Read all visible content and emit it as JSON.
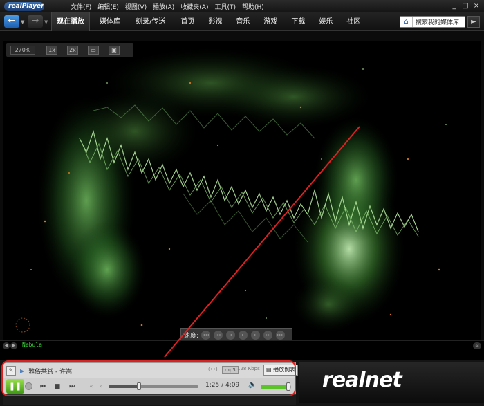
{
  "app": {
    "logo_text": "realPlayer",
    "menu": [
      "文件(F)",
      "编辑(E)",
      "视图(V)",
      "播放(A)",
      "收藏夹(A)",
      "工具(T)",
      "帮助(H)"
    ],
    "window_controls": [
      "_",
      "□",
      "×"
    ]
  },
  "nav": {
    "tabs": [
      {
        "label": "现在播放",
        "active": true
      },
      {
        "label": "媒体库",
        "active": false
      },
      {
        "label": "刻录/传送",
        "active": false
      },
      {
        "label": "首页",
        "active": false
      },
      {
        "label": "影视",
        "active": false
      },
      {
        "label": "音乐",
        "active": false
      },
      {
        "label": "游戏",
        "active": false
      },
      {
        "label": "下载",
        "active": false
      },
      {
        "label": "娱乐",
        "active": false
      },
      {
        "label": "社区",
        "active": false
      }
    ],
    "search_text": "搜索我的媒体库"
  },
  "video": {
    "zoom_level": "270%",
    "zoom_buttons": [
      "1x",
      "2x",
      "▭",
      "▣"
    ],
    "speed_label": "速度:",
    "speed_buttons": [
      "◂◂◂",
      "◂◂",
      "◂",
      "▸",
      "▸",
      "▸▸",
      "▸▸▸"
    ]
  },
  "visualization": {
    "name": "Nebula"
  },
  "player": {
    "track_title": "雅俗共赏 - 许嵩",
    "stereo": "(••)",
    "format": "mp3",
    "bitrate": "128 Kbps",
    "playlist_label": "播放例表",
    "time_readout": "1:25 / 4:09",
    "progress": 0.34,
    "volume": 0.92
  },
  "banner": {
    "text": "realnet"
  },
  "colors": {
    "accent_blue": "#2a62b8",
    "play_green": "#5cc32a",
    "viz_text_green": "#3bd53b",
    "annotation_red": "#e02020"
  },
  "icons": {
    "back": "back-arrow-icon",
    "forward": "forward-arrow-icon",
    "home": "house-icon",
    "pause": "pause-icon",
    "volume": "speaker-icon"
  }
}
